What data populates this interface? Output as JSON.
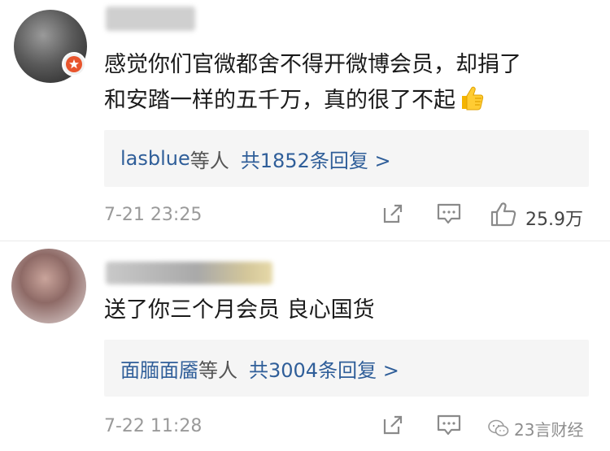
{
  "comments": [
    {
      "text_line1": "感觉你们官微都舍不得开微博会员，却捐了",
      "text_line2": "和安踏一样的五千万，真的很了不起",
      "replies_names": "lasblue",
      "replies_suffix": "等人",
      "replies_count": "共1852条回复 >",
      "timestamp": "7-21 23:25",
      "like_count": "25.9万"
    },
    {
      "text_line1": "送了你三个月会员 良心国货",
      "replies_names": "面腼面靥",
      "replies_suffix": "等人",
      "replies_count": "共3004条回复 >",
      "timestamp": "7-22 11:28"
    }
  ],
  "watermark": {
    "text": "23言财经"
  },
  "colors": {
    "link_blue": "#2f5e99",
    "meta_gray": "#9a9a9a",
    "reply_bg": "#f5f5f5"
  },
  "icons": {
    "share": "share-icon",
    "comment": "comment-icon",
    "like": "thumbs-up-icon",
    "emoji": "thumbs-up-emoji",
    "badge": "verified-badge-icon",
    "watermark": "wechat-icon"
  }
}
